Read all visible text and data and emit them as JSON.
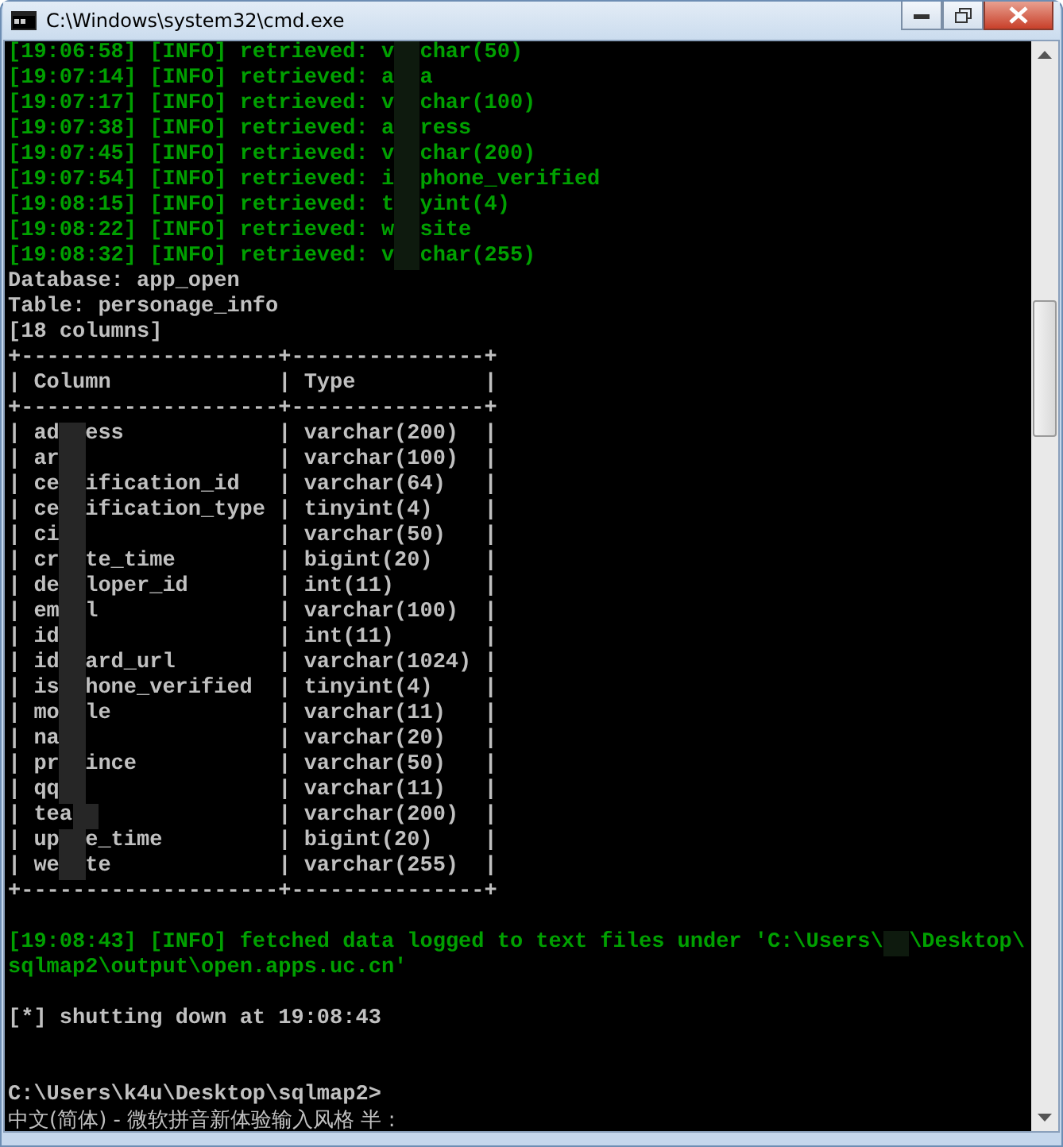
{
  "window": {
    "title": "C:\\Windows\\system32\\cmd.exe"
  },
  "console_lines": [
    {
      "kind": "info",
      "parts": [
        "[19:06:58] [INFO] retrieved: v",
        "char(50)"
      ]
    },
    {
      "kind": "info",
      "parts": [
        "[19:07:14] [INFO] retrieved: a",
        "a"
      ]
    },
    {
      "kind": "info",
      "parts": [
        "[19:07:17] [INFO] retrieved: v",
        "char(100)"
      ]
    },
    {
      "kind": "info",
      "parts": [
        "[19:07:38] [INFO] retrieved: a",
        "ress"
      ]
    },
    {
      "kind": "info",
      "parts": [
        "[19:07:45] [INFO] retrieved: v",
        "char(200)"
      ]
    },
    {
      "kind": "info",
      "parts": [
        "[19:07:54] [INFO] retrieved: i",
        "phone_verified"
      ]
    },
    {
      "kind": "info",
      "parts": [
        "[19:08:15] [INFO] retrieved: t",
        "yint(4)"
      ]
    },
    {
      "kind": "info",
      "parts": [
        "[19:08:22] [INFO] retrieved: w",
        "site"
      ]
    },
    {
      "kind": "info",
      "parts": [
        "[19:08:32] [INFO] retrieved: v",
        "char(255)"
      ]
    },
    {
      "kind": "plain",
      "parts": [
        "Database: app_open"
      ]
    },
    {
      "kind": "plain",
      "parts": [
        "Table: personage_info"
      ]
    },
    {
      "kind": "plain",
      "parts": [
        "[18 columns]"
      ]
    },
    {
      "kind": "plain",
      "parts": [
        "+--------------------+---------------+"
      ]
    },
    {
      "kind": "plain",
      "parts": [
        "| Column             | Type          |"
      ]
    },
    {
      "kind": "plain",
      "parts": [
        "+--------------------+---------------+"
      ]
    },
    {
      "kind": "plain",
      "parts": [
        "| ad",
        "ess            | varchar(200)  |"
      ]
    },
    {
      "kind": "plain",
      "parts": [
        "| ar",
        "               | varchar(100)  |"
      ]
    },
    {
      "kind": "plain",
      "parts": [
        "| ce",
        "ification_id   | varchar(64)   |"
      ]
    },
    {
      "kind": "plain",
      "parts": [
        "| ce",
        "ification_type | tinyint(4)    |"
      ]
    },
    {
      "kind": "plain",
      "parts": [
        "| ci",
        "               | varchar(50)   |"
      ]
    },
    {
      "kind": "plain",
      "parts": [
        "| cr",
        "te_time        | bigint(20)    |"
      ]
    },
    {
      "kind": "plain",
      "parts": [
        "| de",
        "loper_id       | int(11)       |"
      ]
    },
    {
      "kind": "plain",
      "parts": [
        "| em",
        "l              | varchar(100)  |"
      ]
    },
    {
      "kind": "plain",
      "parts": [
        "| id",
        "               | int(11)       |"
      ]
    },
    {
      "kind": "plain",
      "parts": [
        "| id",
        "ard_url        | varchar(1024) |"
      ]
    },
    {
      "kind": "plain",
      "parts": [
        "| is",
        "hone_verified  | tinyint(4)    |"
      ]
    },
    {
      "kind": "plain",
      "parts": [
        "| mo",
        "le             | varchar(11)   |"
      ]
    },
    {
      "kind": "plain",
      "parts": [
        "| na",
        "               | varchar(20)   |"
      ]
    },
    {
      "kind": "plain",
      "parts": [
        "| pr",
        "ince           | varchar(50)   |"
      ]
    },
    {
      "kind": "plain",
      "parts": [
        "| qq",
        "               | varchar(11)   |"
      ]
    },
    {
      "kind": "plain",
      "parts": [
        "| tea",
        "              | varchar(200)  |"
      ]
    },
    {
      "kind": "plain",
      "parts": [
        "| up",
        "e_time         | bigint(20)    |"
      ]
    },
    {
      "kind": "plain",
      "parts": [
        "| we",
        "te             | varchar(255)  |"
      ]
    },
    {
      "kind": "plain",
      "parts": [
        "+--------------------+---------------+"
      ]
    },
    {
      "kind": "blank"
    },
    {
      "kind": "info",
      "parts": [
        "[19:08:43] [INFO] fetched data logged to text files under 'C:\\Users\\",
        "\\Desktop\\"
      ]
    },
    {
      "kind": "info",
      "parts": [
        "sqlmap2\\output\\open.apps.uc.cn'"
      ]
    },
    {
      "kind": "blank"
    },
    {
      "kind": "plain",
      "parts": [
        "[*] shutting down at 19:08:43"
      ]
    },
    {
      "kind": "blank"
    },
    {
      "kind": "blank"
    },
    {
      "kind": "plain",
      "parts": [
        "C:\\Users\\k4u\\Desktop\\sqlmap2>"
      ]
    },
    {
      "kind": "ime",
      "parts": [
        "中文(简体) - 微软拼音新体验输入风格 半 :"
      ]
    }
  ]
}
